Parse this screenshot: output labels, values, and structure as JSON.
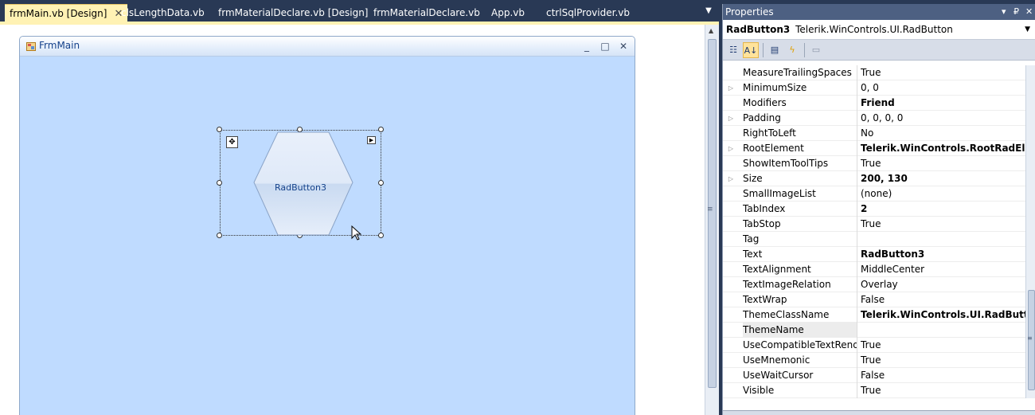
{
  "tabs": [
    {
      "label": "frmMain.vb [Design]",
      "active": true
    },
    {
      "label": "clsLengthData.vb"
    },
    {
      "label": "frmMaterialDeclare.vb [Design]"
    },
    {
      "label": "frmMaterialDeclare.vb"
    },
    {
      "label": "App.vb"
    },
    {
      "label": "ctrlSqlProvider.vb"
    }
  ],
  "close_glyph": "✕",
  "overflow_glyph": "▼",
  "form": {
    "title": "FrmMain",
    "minimize": "_",
    "maximize": "□",
    "close": "✕",
    "background": "#bfdbff"
  },
  "radbutton": {
    "text": "RadButton3"
  },
  "properties": {
    "title": "Properties",
    "pin_glyph": "▾ ₽",
    "close_glyph": "✕",
    "object_name": "RadButton3",
    "object_type": "Telerik.WinControls.UI.RadButton",
    "toolbar": {
      "categorized_icon": "categorized-icon",
      "alphabetical_icon": "alphabetical-icon",
      "properties_icon": "properties-icon",
      "events_icon": "events-icon",
      "pages_icon": "property-pages-icon"
    },
    "rows": [
      {
        "name": "MeasureTrailingSpaces",
        "value": "True",
        "expand": false,
        "bold": false
      },
      {
        "name": "MinimumSize",
        "value": "0, 0",
        "expand": true,
        "bold": false
      },
      {
        "name": "Modifiers",
        "value": "Friend",
        "expand": false,
        "bold": true
      },
      {
        "name": "Padding",
        "value": "0, 0, 0, 0",
        "expand": true,
        "bold": false
      },
      {
        "name": "RightToLeft",
        "value": "No",
        "expand": false,
        "bold": false
      },
      {
        "name": "RootElement",
        "value": "Telerik.WinControls.RootRadElement",
        "expand": true,
        "bold": true
      },
      {
        "name": "ShowItemToolTips",
        "value": "True",
        "expand": false,
        "bold": false
      },
      {
        "name": "Size",
        "value": "200, 130",
        "expand": true,
        "bold": true
      },
      {
        "name": "SmallImageList",
        "value": "(none)",
        "expand": false,
        "bold": false
      },
      {
        "name": "TabIndex",
        "value": "2",
        "expand": false,
        "bold": true
      },
      {
        "name": "TabStop",
        "value": "True",
        "expand": false,
        "bold": false
      },
      {
        "name": "Tag",
        "value": "",
        "expand": false,
        "bold": false
      },
      {
        "name": "Text",
        "value": "RadButton3",
        "expand": false,
        "bold": true
      },
      {
        "name": "TextAlignment",
        "value": "MiddleCenter",
        "expand": false,
        "bold": false
      },
      {
        "name": "TextImageRelation",
        "value": "Overlay",
        "expand": false,
        "bold": false
      },
      {
        "name": "TextWrap",
        "value": "False",
        "expand": false,
        "bold": false
      },
      {
        "name": "ThemeClassName",
        "value": "Telerik.WinControls.UI.RadButton",
        "expand": false,
        "bold": true
      },
      {
        "name": "ThemeName",
        "value": "",
        "expand": false,
        "bold": false,
        "selected": true
      },
      {
        "name": "UseCompatibleTextRendering",
        "value": "True",
        "expand": false,
        "bold": false
      },
      {
        "name": "UseMnemonic",
        "value": "True",
        "expand": false,
        "bold": false
      },
      {
        "name": "UseWaitCursor",
        "value": "False",
        "expand": false,
        "bold": false
      },
      {
        "name": "Visible",
        "value": "True",
        "expand": false,
        "bold": false
      }
    ]
  }
}
